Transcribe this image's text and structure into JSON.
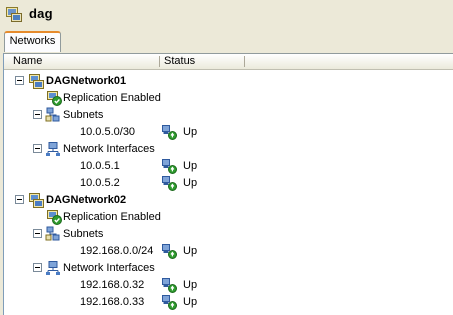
{
  "window": {
    "title": "dag"
  },
  "tabs": [
    {
      "label": "Networks"
    }
  ],
  "columns": {
    "name": "Name",
    "status": "Status"
  },
  "networks": [
    {
      "name": "DAGNetwork01",
      "replication": "Replication Enabled",
      "subnets_label": "Subnets",
      "subnets": [
        {
          "name": "10.0.5.0/30",
          "status": "Up"
        }
      ],
      "interfaces_label": "Network Interfaces",
      "interfaces": [
        {
          "name": "10.0.5.1",
          "status": "Up"
        },
        {
          "name": "10.0.5.2",
          "status": "Up"
        }
      ]
    },
    {
      "name": "DAGNetwork02",
      "replication": "Replication Enabled",
      "subnets_label": "Subnets",
      "subnets": [
        {
          "name": "192.168.0.0/24",
          "status": "Up"
        }
      ],
      "interfaces_label": "Network Interfaces",
      "interfaces": [
        {
          "name": "192.168.0.32",
          "status": "Up"
        },
        {
          "name": "192.168.0.33",
          "status": "Up"
        }
      ]
    }
  ],
  "icons": {
    "network": "network-icon",
    "replication": "replication-enabled-icon",
    "subnets": "subnets-icon",
    "interfaces": "network-interfaces-icon",
    "status_up": "status-up-icon"
  }
}
